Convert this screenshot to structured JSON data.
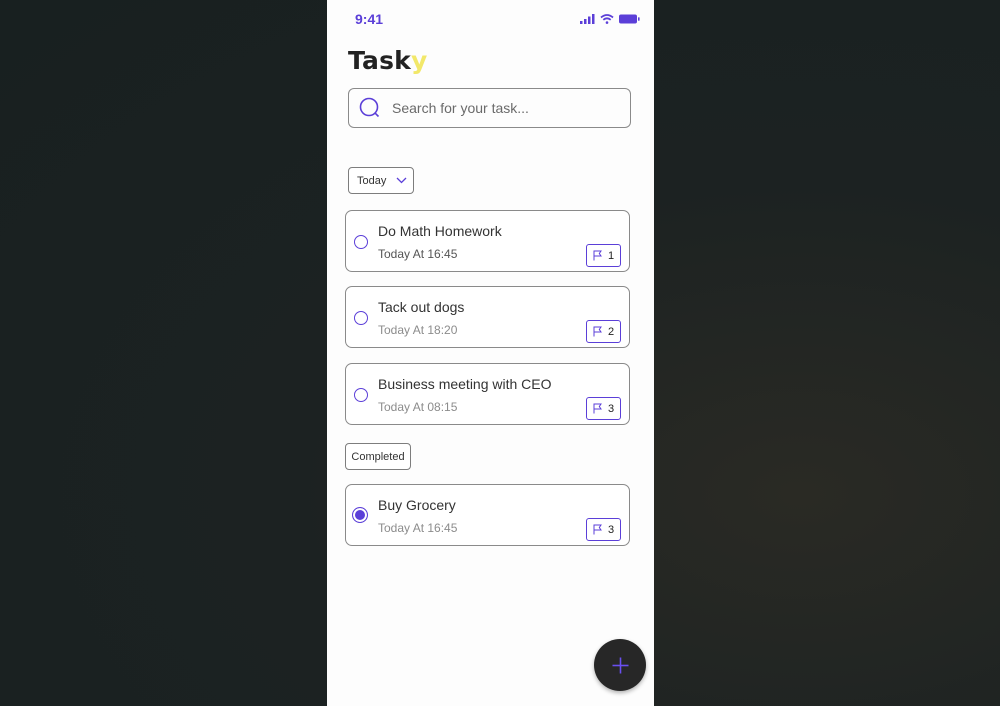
{
  "status_bar": {
    "time": "9:41"
  },
  "app": {
    "title_main": "Task",
    "title_accent": "y"
  },
  "search": {
    "placeholder": "Search for your task..."
  },
  "filter": {
    "label": "Today"
  },
  "tasks": [
    {
      "title": "Do Math Homework",
      "time": "Today At 16:45",
      "priority": "1",
      "completed": false
    },
    {
      "title": "Tack out dogs",
      "time": "Today At 18:20",
      "priority": "2",
      "completed": false
    },
    {
      "title": "Business meeting with CEO",
      "time": "Today At 08:15",
      "priority": "3",
      "completed": false
    }
  ],
  "completed_section": {
    "label": "Completed",
    "tasks": [
      {
        "title": "Buy Grocery",
        "time": "Today At 16:45",
        "priority": "3",
        "completed": true
      }
    ]
  },
  "colors": {
    "accent": "#5b3fd8",
    "logo_accent": "#f2e86a",
    "fab": "#272727"
  },
  "icons": [
    "signal-icon",
    "wifi-icon",
    "battery-icon",
    "search-icon",
    "chevron-down-icon",
    "flag-icon",
    "plus-icon"
  ]
}
